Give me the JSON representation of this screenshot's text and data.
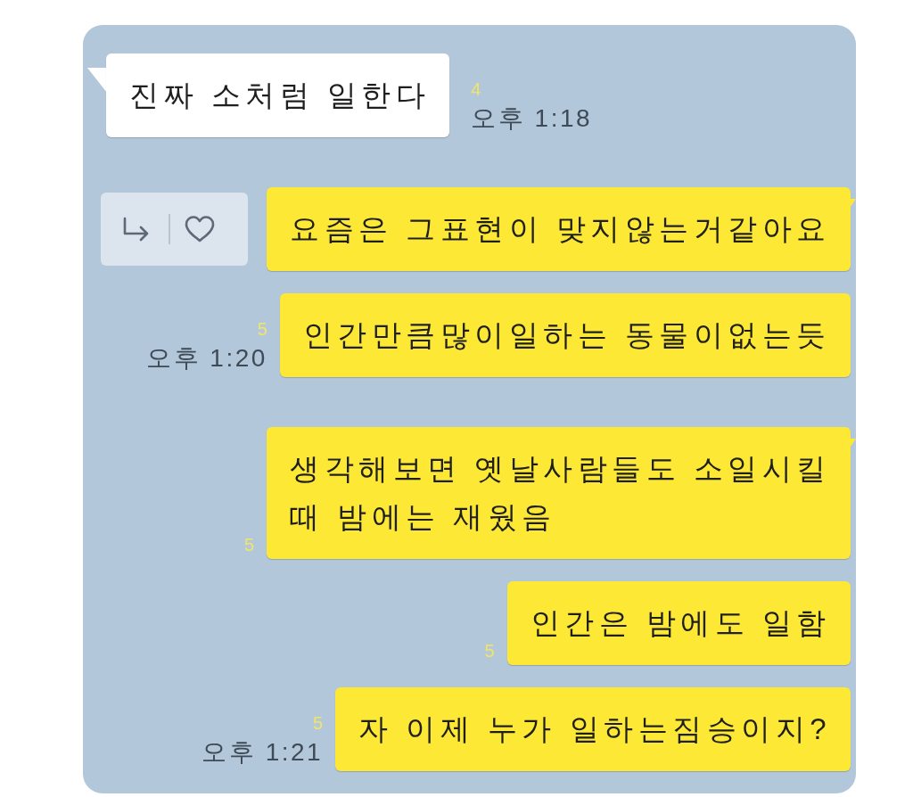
{
  "chat": {
    "messages": [
      {
        "kind": "received",
        "lines": [
          "진짜 소처럼 일한다"
        ],
        "tail": true,
        "unread": "4",
        "time": "오후 1:18",
        "actions": false
      },
      {
        "kind": "sent",
        "lines": [
          "요즘은 그표현이 맞지않는거같아요"
        ],
        "tail": true,
        "actions": true
      },
      {
        "kind": "sent",
        "lines": [
          "인간만큼많이일하는 동물이없는듯"
        ],
        "tail": false,
        "unread": "5",
        "time": "오후 1:20",
        "actions": false
      },
      {
        "kind": "sent",
        "lines": [
          "생각해보면 옛날사람들도 소일시킬",
          "때 밤에는 재웠음"
        ],
        "tail": true,
        "unread": "5",
        "actions": false
      },
      {
        "kind": "sent",
        "lines": [
          "인간은 밤에도 일함"
        ],
        "tail": false,
        "unread": "5",
        "actions": false
      },
      {
        "kind": "sent",
        "lines": [
          "자 이제 누가 일하는짐승이지?"
        ],
        "tail": false,
        "unread": "5",
        "time": "오후 1:21",
        "actions": false
      }
    ]
  }
}
